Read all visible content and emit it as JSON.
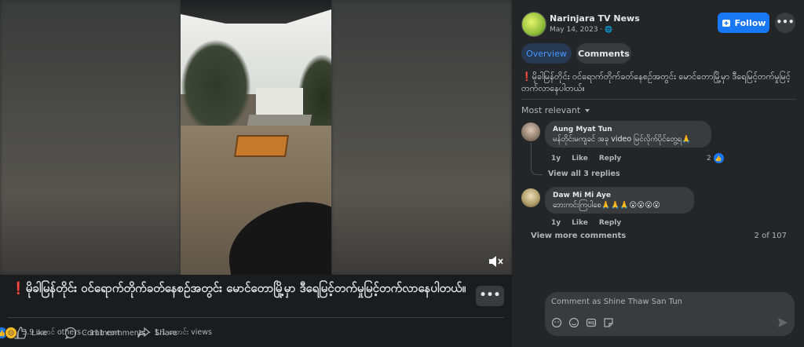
{
  "video": {
    "mute_icon": "mute-speaker-icon"
  },
  "post": {
    "alert_mark": "❗",
    "caption": "မိုခါမြန်တိုင်း ဝင်ရောက်တိုက်ခတ်နေစဉ်အတွင်း မောင်တောမြို့မှာ ဒီရေမြင့်တက်မှုမြင့်တက်လာနေပါတယ်။",
    "more_label": "•••"
  },
  "actions": {
    "like_label": "Like",
    "comment_label": "Comment",
    "share_label": "Share"
  },
  "stats": {
    "reactions": "3.9 ထောင် others",
    "comments": "111 comments",
    "views": "1.1 သောင်း views",
    "sep": "·"
  },
  "page": {
    "name": "Narinjara TV News",
    "date": "May 14, 2023 · ",
    "globe": "🌐",
    "follow_label": "Follow",
    "more_label": "•••"
  },
  "tabs": {
    "overview": "Overview",
    "comments": "Comments"
  },
  "post_text": "မိုခါမြန်တိုင်း ဝင်ရောက်တိုက်ခတ်နေစဉ်အတွင်း မောင်တောမြို့မှာ ဒီရေမြင့်တက်မှုမြင့်တက်လာနေပါတယ်။",
  "sort_label": "Most relevant",
  "comments": [
    {
      "name": "Aung Myat Tun",
      "text": "မန်တိုင်းမကျခင် အခု video မြင်လိုက်ပိုင်တွေ့ရ🙏",
      "age": "1y",
      "like": "Like",
      "reply": "Reply",
      "likes": "2"
    },
    {
      "name": "Daw Mi Mi Aye",
      "text": "ဘေးကင်းကြပါစေ🙏🙏🙏😮😮😮😮",
      "age": "1y",
      "like": "Like",
      "reply": "Reply"
    }
  ],
  "view_replies": "View all 3 replies",
  "view_more": "View more comments",
  "pager": "2 of 107",
  "comment_box": {
    "placeholder": "Comment as Shine Thaw San Tun"
  },
  "colors": {
    "accent": "#1877f2",
    "bg": "#242526",
    "alert": "#e53e3e"
  }
}
